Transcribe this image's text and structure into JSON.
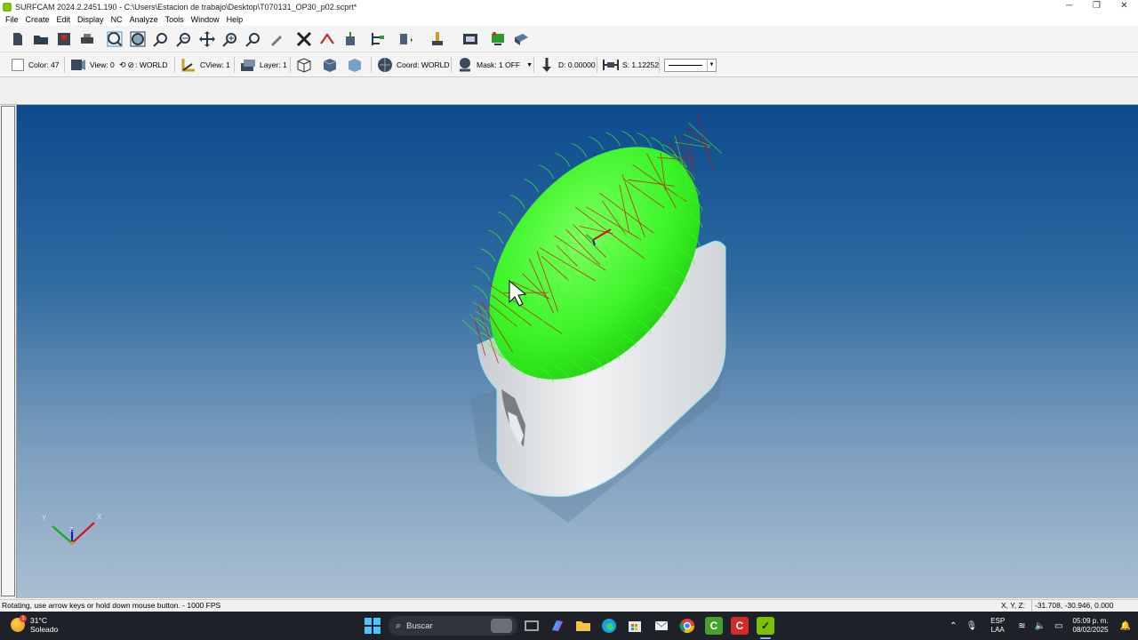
{
  "window": {
    "title": "SURFCAM 2024.2.2451.190 - C:\\Users\\Estacion de trabajo\\Desktop\\T070131_OP30_p02.scprt*",
    "minimize": "─",
    "maximize": "❐",
    "close": "✕"
  },
  "menu": {
    "items": [
      "File",
      "Create",
      "Edit",
      "Display",
      "NC",
      "Analyze",
      "Tools",
      "Window",
      "Help"
    ]
  },
  "toolbar2": {
    "color": "Color: 47",
    "view": "View: 0",
    "world": ": WORLD",
    "cview": "CView: 1",
    "layer": "Layer: 1",
    "coord": "Coord: WORLD",
    "mask": "Mask: 1 OFF",
    "depth": "D: 0.00000",
    "step": "S: 1.12252"
  },
  "viewport": {
    "axis_labels": {
      "x": "X",
      "y": "Y",
      "z": "Z"
    }
  },
  "status": {
    "message": "Rotating, use arrow keys or hold down mouse button.  -  1000 FPS",
    "coords_label": "X, Y, Z:",
    "coords_value": "-31.708, -30.946, 0.000"
  },
  "taskbar": {
    "temperature": "31°C",
    "condition": "Soleado",
    "weather_badge": "1",
    "search_placeholder": "Buscar",
    "lang_1": "ESP",
    "lang_2": "LAA",
    "time": "05:09 p. m.",
    "date": "08/02/2025"
  },
  "colors": {
    "viewport_top": "#0c4a8c",
    "viewport_bottom": "#a9bfd2",
    "toolpath_green": "#33ff22",
    "toolpath_red": "#cc1111",
    "part_body": "#e4e6e8"
  }
}
